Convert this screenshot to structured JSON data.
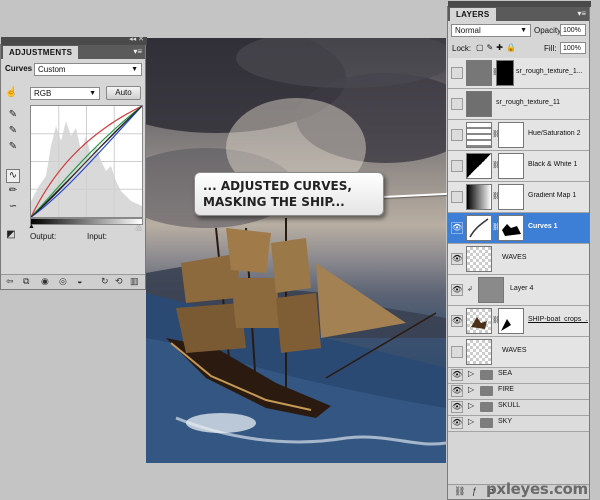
{
  "adjustments": {
    "tab_label": "ADJUSTMENTS",
    "preset_label": "Curves",
    "preset_value": "Custom",
    "channel_value": "RGB",
    "auto_label": "Auto",
    "output_label": "Output:",
    "input_label": "Input:"
  },
  "callout": {
    "line1": "... ADJUSTED CURVES,",
    "line2": "MASKING THE SHIP..."
  },
  "layers": {
    "tab_label": "LAYERS",
    "blend_mode": "Normal",
    "opacity_label": "Opacity:",
    "opacity_value": "100%",
    "lock_label": "Lock:",
    "fill_label": "Fill:",
    "fill_value": "100%",
    "items": [
      {
        "name": "sr_rough_texture_1..."
      },
      {
        "name": "sr_rough_texture_11"
      },
      {
        "name": "Hue/Saturation 2"
      },
      {
        "name": "Black & White 1"
      },
      {
        "name": "Gradient Map 1"
      },
      {
        "name": "Curves 1"
      },
      {
        "name": "WAVES"
      },
      {
        "name": "Layer 4"
      },
      {
        "name": "SHIP-boat_crops_..."
      },
      {
        "name": "WAVES"
      },
      {
        "name": "SEA"
      },
      {
        "name": "FIRE"
      },
      {
        "name": "SKULL"
      },
      {
        "name": "SKY"
      }
    ]
  },
  "watermark": "pxleyes.com"
}
